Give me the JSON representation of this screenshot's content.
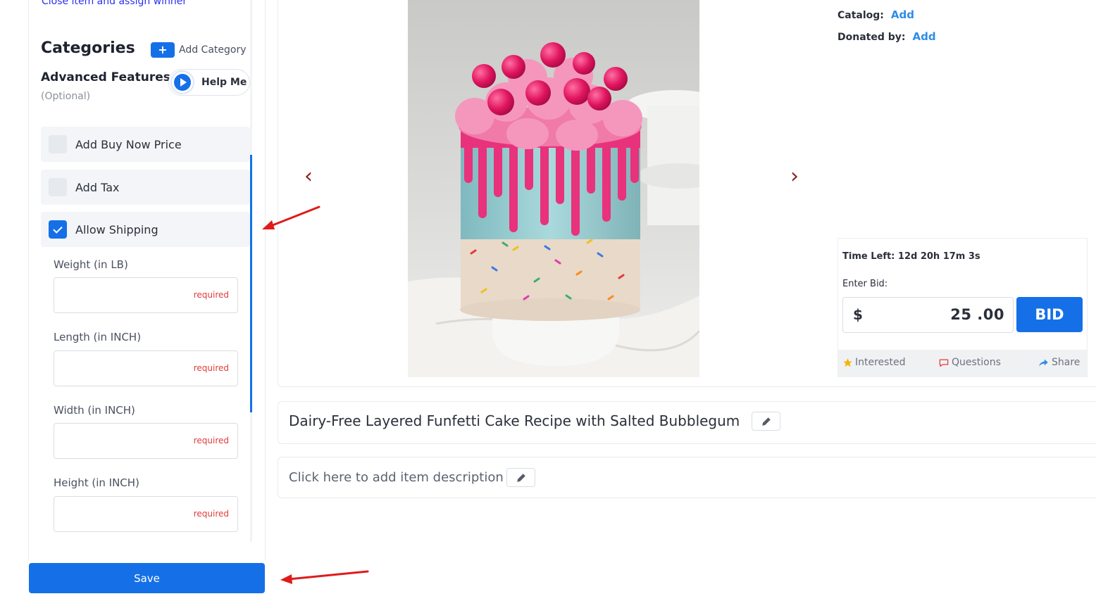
{
  "sidebar": {
    "close_link": "Close item and assign winner",
    "categories_title": "Categories",
    "add_category_label": "Add Category",
    "advanced_title": "Advanced Features",
    "optional_label": "(Optional)",
    "help_label": "Help Me",
    "features": [
      {
        "label": "Add Buy Now Price",
        "checked": false
      },
      {
        "label": "Add Tax",
        "checked": false
      },
      {
        "label": "Allow Shipping",
        "checked": true
      }
    ],
    "shipping_fields": [
      {
        "label": "Weight (in LB)",
        "hint": "required"
      },
      {
        "label": "Length (in INCH)",
        "hint": "required"
      },
      {
        "label": "Width (in INCH)",
        "hint": "required"
      },
      {
        "label": "Height (in INCH)",
        "hint": "required"
      }
    ],
    "save_label": "Save"
  },
  "gallery": {
    "prev_glyph": "‹",
    "next_glyph": "›"
  },
  "details": {
    "catalog_label": "Catalog:",
    "catalog_link": "Add",
    "donated_label": "Donated by:",
    "donated_link": "Add"
  },
  "bid": {
    "time_left": "Time Left: 12d 20h 17m 3s",
    "enter_bid_label": "Enter Bid:",
    "currency": "$",
    "amount": "25 .00",
    "bid_button": "BID",
    "interested_label": "Interested",
    "questions_label": "Questions",
    "share_label": "Share"
  },
  "item": {
    "title": "Dairy-Free Layered Funfetti Cake Recipe with Salted Bubblegum",
    "description_placeholder": "Click here to add item description"
  },
  "colors": {
    "primary": "#1570e8",
    "link": "#2f8ce8",
    "required": "#e23b3b",
    "annotation_arrow": "#e01b1b"
  },
  "icons": [
    "plus-icon",
    "play-icon",
    "checkmark-icon",
    "chevron-left-icon",
    "chevron-right-icon",
    "star-icon",
    "comment-icon",
    "share-icon",
    "pencil-icon"
  ]
}
